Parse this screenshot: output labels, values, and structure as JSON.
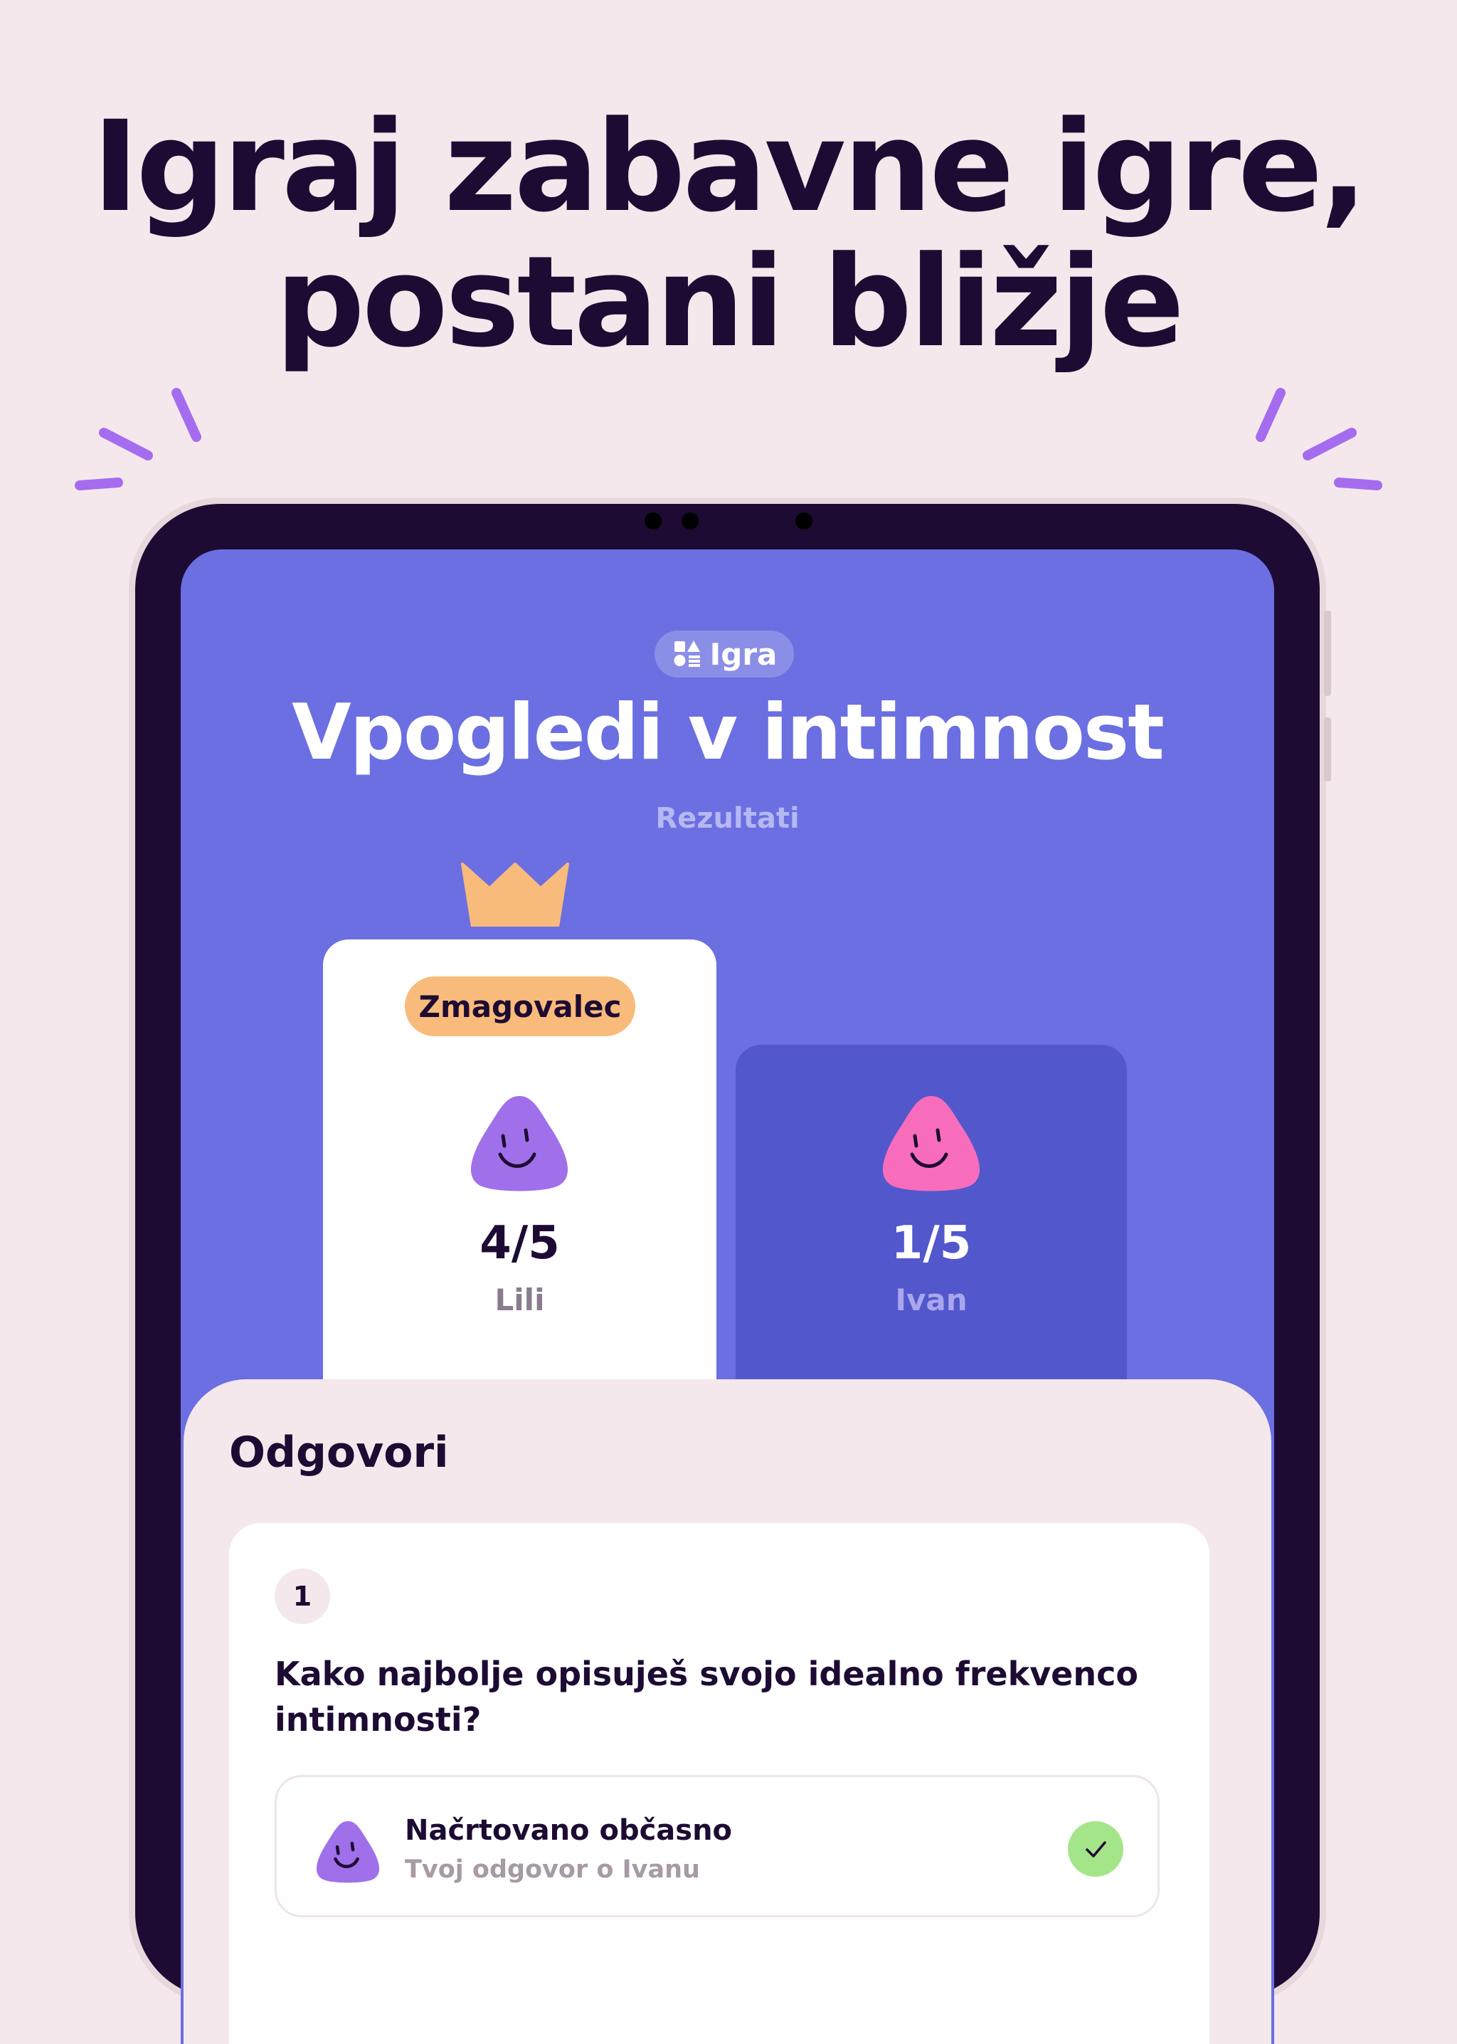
{
  "headline": {
    "line1": "Igraj zabavne igre,",
    "line2": "postani bližje"
  },
  "screen": {
    "tag_label": "Igra",
    "title": "Vpogledi v intimnost",
    "subtitle": "Rezultati",
    "players": [
      {
        "badge": "Zmagovalec",
        "score": "4/5",
        "name": "Lili",
        "avatar_color": "#a070ea",
        "winner": true
      },
      {
        "score": "1/5",
        "name": "Ivan",
        "avatar_color": "#f76dbc",
        "winner": false
      }
    ]
  },
  "answers": {
    "heading": "Odgovori",
    "question_number": "1",
    "question": "Kako najbolje opisuješ svojo idealno frekvenco intimnosti?",
    "answer_title": "Načrtovano občasno",
    "answer_subtitle": "Tvoj odgovor o Ivanu"
  },
  "colors": {
    "background": "#f4e8ec",
    "screen": "#6b6fe1",
    "accent": "#a56cf0",
    "badge": "#f8bb7b",
    "check": "#a5e589"
  }
}
